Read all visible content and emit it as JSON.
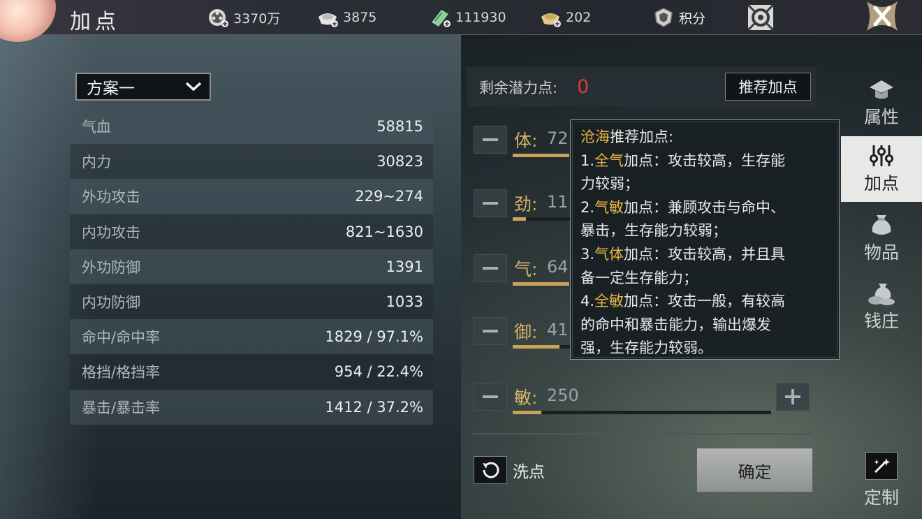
{
  "header": {
    "title": "加点",
    "resources": [
      {
        "icon": "film-reel-coin-icon",
        "value": "3370万"
      },
      {
        "icon": "silver-ingot-icon",
        "value": "3875"
      },
      {
        "icon": "jade-token-icon",
        "value": "111930"
      },
      {
        "icon": "gold-ingot-icon",
        "value": "202"
      }
    ],
    "points_label": "积分"
  },
  "plan": {
    "selected": "方案一"
  },
  "stats": [
    {
      "label": "气血",
      "value": "58815"
    },
    {
      "label": "内力",
      "value": "30823"
    },
    {
      "label": "外功攻击",
      "value": "229~274"
    },
    {
      "label": "内功攻击",
      "value": "821~1630"
    },
    {
      "label": "外功防御",
      "value": "1391"
    },
    {
      "label": "内功防御",
      "value": "1033"
    },
    {
      "label": "命中/命中率",
      "value": "1829 / 97.1%"
    },
    {
      "label": "格挡/格挡率",
      "value": "954 / 22.4%"
    },
    {
      "label": "暴击/暴击率",
      "value": "1412 / 37.2%"
    }
  ],
  "allocation": {
    "remaining_label": "剩余潜力点:",
    "remaining_value": "0",
    "recommend_label": "推荐加点",
    "attributes": [
      {
        "label": "体:",
        "value": "72",
        "fill": 0.22
      },
      {
        "label": "劲:",
        "value": "11",
        "fill": 0.05
      },
      {
        "label": "气:",
        "value": "64",
        "fill": 0.22
      },
      {
        "label": "御:",
        "value": "41",
        "fill": 0.18
      },
      {
        "label": "敏:",
        "value": "250",
        "fill": 0.11
      }
    ],
    "wash_label": "洗点",
    "confirm_label": "确定"
  },
  "tooltip": {
    "title_highlight": "沧海",
    "title_rest": "推荐加点:",
    "items": [
      {
        "prefix": "1.",
        "highlight": "全气",
        "text": "加点：攻击较高，生存能",
        "cont": "力较弱；"
      },
      {
        "prefix": "2.",
        "highlight": "气敏",
        "text": "加点：兼顾攻击与命中、",
        "cont": "暴击，生存能力较弱；"
      },
      {
        "prefix": "3.",
        "highlight": "气体",
        "text": "加点：攻击较高，并且具",
        "cont": "备一定生存能力；"
      },
      {
        "prefix": "4.",
        "highlight": "全敏",
        "text": "加点：攻击一般，有较高",
        "cont": "的命中和暴击能力，输出爆发",
        "cont2": "强，生存能力较弱。"
      }
    ]
  },
  "sidenav": {
    "items": [
      {
        "label": "属性",
        "icon": "hat-icon"
      },
      {
        "label": "加点",
        "icon": "sliders-icon"
      },
      {
        "label": "物品",
        "icon": "bag-icon"
      },
      {
        "label": "钱庄",
        "icon": "money-bag-icon"
      }
    ],
    "custom_label": "定制"
  },
  "colors": {
    "accent_gold": "#d8b46a",
    "alert_red": "#e03a2f",
    "highlight": "#e8b646"
  }
}
